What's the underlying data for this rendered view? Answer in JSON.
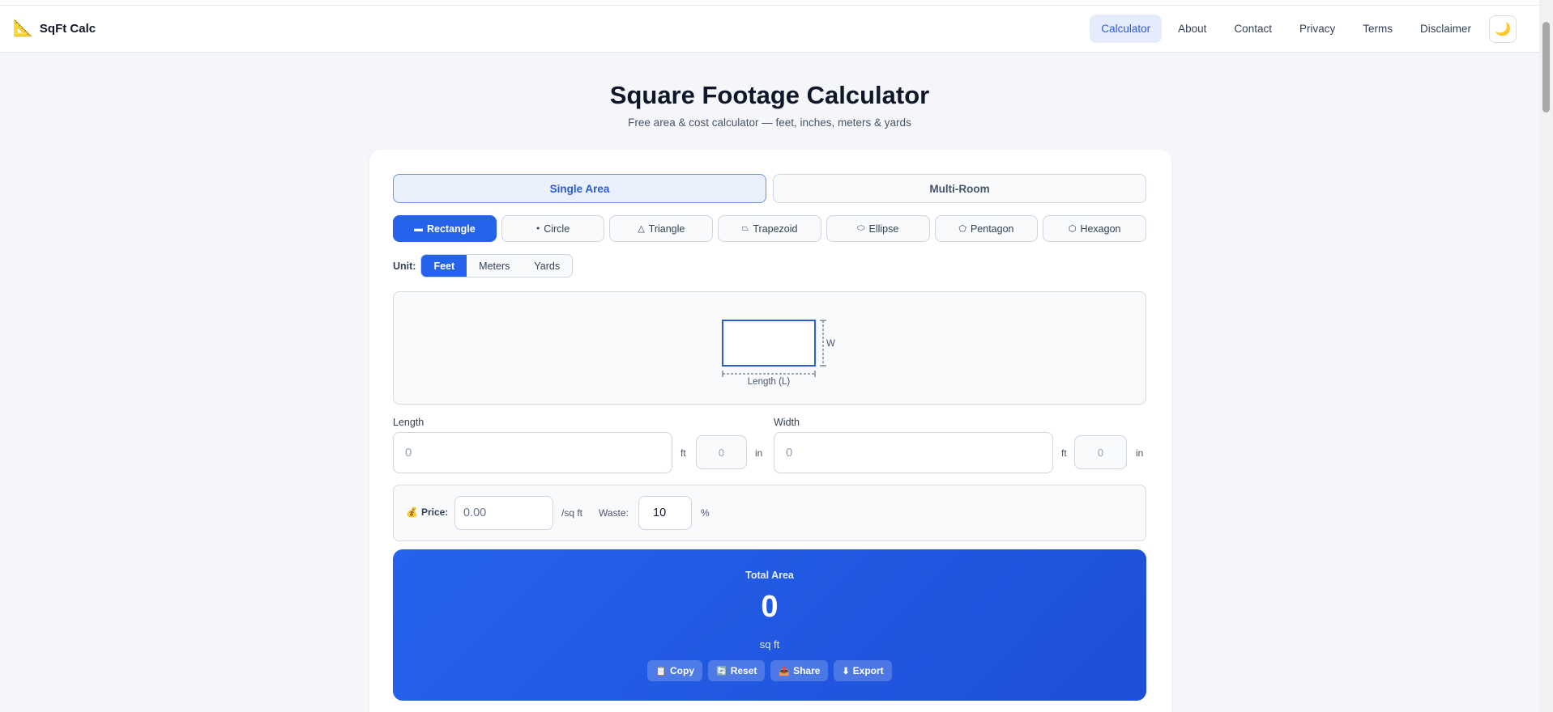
{
  "header": {
    "brand_icon": "triangular-ruler-icon",
    "brand_name": "SqFt Calc",
    "nav": [
      "Calculator",
      "About",
      "Contact",
      "Privacy",
      "Terms",
      "Disclaimer"
    ],
    "active_nav": "Calculator",
    "theme_icon": "moon-icon"
  },
  "main": {
    "title": "Square Footage Calculator",
    "subtitle": "Free area & cost calculator — feet, inches, meters & yards"
  },
  "calculator": {
    "mode_tabs": [
      "Single Area",
      "Multi-Room"
    ],
    "active_mode": "Single Area",
    "shapes": [
      {
        "label": "Rectangle",
        "glyph": "▬",
        "active": true
      },
      {
        "label": "Circle",
        "glyph": "●",
        "active": false
      },
      {
        "label": "Triangle",
        "glyph": "△",
        "active": false
      },
      {
        "label": "Trapezoid",
        "glyph": "⏢",
        "active": false
      },
      {
        "label": "Ellipse",
        "glyph": "⬭",
        "active": false
      },
      {
        "label": "Pentagon",
        "glyph": "⬠",
        "active": false
      },
      {
        "label": "Hexagon",
        "glyph": "⬡",
        "active": false
      }
    ],
    "unit_label": "Unit:",
    "units": [
      "Feet",
      "Meters",
      "Yards"
    ],
    "active_unit": "Feet",
    "diagram": {
      "length_label": "Length (L)",
      "width_label": "W"
    },
    "length": {
      "label": "Length",
      "placeholder": "0",
      "unit": "ft",
      "inch_placeholder": "0",
      "inch_unit": "in"
    },
    "width": {
      "label": "Width",
      "placeholder": "0",
      "unit": "ft",
      "inch_placeholder": "0",
      "inch_unit": "in"
    },
    "price": {
      "icon": "money-bag-icon",
      "label": "Price:",
      "placeholder": "0.00",
      "unit": "/sq ft"
    },
    "waste": {
      "label": "Waste:",
      "value": "10",
      "unit": "%"
    }
  },
  "result": {
    "label": "Total Area",
    "value": "0",
    "unit": "sq ft",
    "actions": [
      {
        "label": "Copy",
        "icon": "📋"
      },
      {
        "label": "Reset",
        "icon": "🔄"
      },
      {
        "label": "Share",
        "icon": "📤"
      },
      {
        "label": "Export",
        "icon": "⬇"
      }
    ]
  },
  "colors": {
    "accent": "#2563eb",
    "active_nav_bg": "#e5ecfb",
    "background": "#f4f6f9"
  }
}
